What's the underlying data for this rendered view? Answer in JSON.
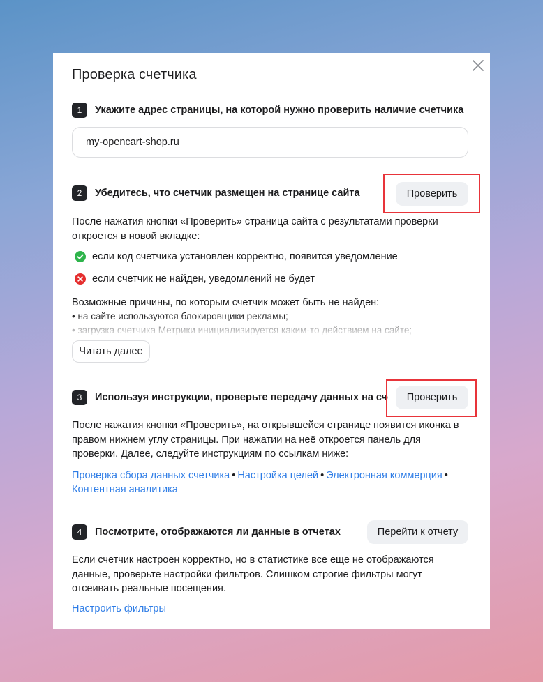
{
  "modal": {
    "title": "Проверка счетчика",
    "close_icon": "close-icon"
  },
  "step1": {
    "number": "1",
    "title": "Укажите адрес страницы, на которой нужно проверить наличие счетчика",
    "input_value": "my-opencart-shop.ru"
  },
  "step2": {
    "number": "2",
    "title": "Убедитесь, что счетчик размещен на странице сайта",
    "button_label": "Проверить",
    "description": "После нажатия кнопки «Проверить» страница сайта с результатами проверки откроется в новой вкладке:",
    "success_text": "если код счетчика установлен корректно, появится уведомление",
    "fail_text": "если счетчик не найден, уведомлений не будет",
    "reasons_title": "Возможные причины, по которым счетчик может быть не найден:",
    "reasons": [
      "• на сайте используются блокировщики рекламы;",
      "• загрузка счетчика Метрики инициализируется каким-то действием на сайте;"
    ],
    "read_more_label": "Читать далее",
    "success_icon": "check-circle-icon",
    "fail_icon": "error-circle-icon"
  },
  "step3": {
    "number": "3",
    "title": "Используя инструкции, проверьте передачу данных на счетчик",
    "button_label": "Проверить",
    "description": "После нажатия кнопки «Проверить», на открывшейся странице появится иконка в правом нижнем углу страницы. При нажатии на неё откроется панель для проверки. Далее, следуйте инструкциям по ссылкам ниже:",
    "links": [
      "Проверка сбора данных счетчика",
      "Настройка целей",
      "Электронная коммерция",
      "Контентная аналитика"
    ],
    "separator": "•"
  },
  "step4": {
    "number": "4",
    "title": "Посмотрите, отображаются ли данные в отчетах",
    "button_label": "Перейти к отчету",
    "description": "Если счетчик настроен корректно, но в статистике все еще не отображаются данные, проверьте настройки фильтров. Слишком строгие фильтры могут отсеивать реальные посещения.",
    "filters_link": "Настроить фильтры"
  },
  "colors": {
    "accent_link": "#2d7ce6",
    "highlight": "#e8343a",
    "success": "#2eb44b",
    "error": "#e52e2e"
  }
}
